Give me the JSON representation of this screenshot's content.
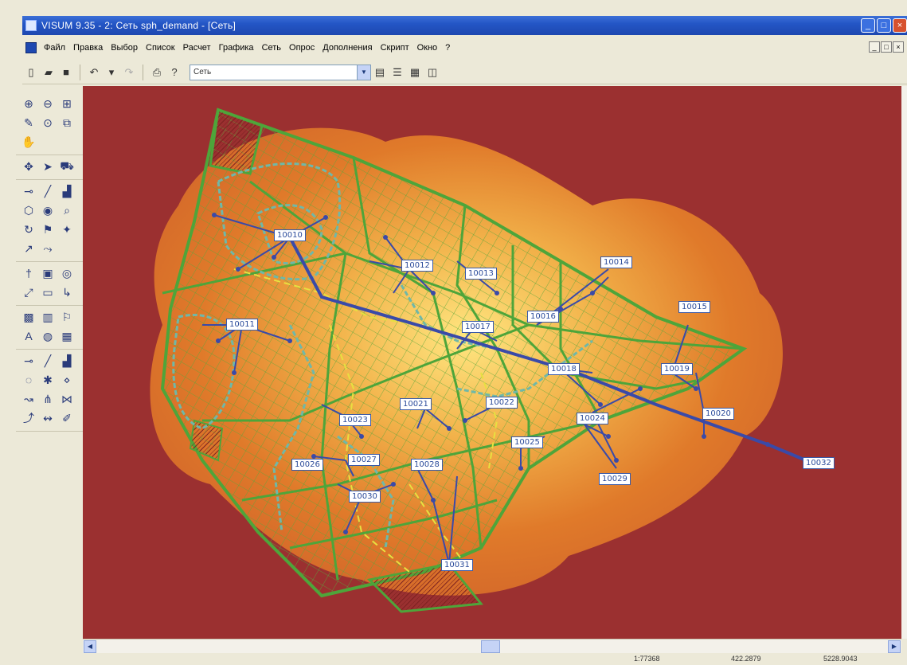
{
  "window": {
    "title": "VISUM 9.35 - 2: Сеть  sph_demand - [Сеть]",
    "buttons": [
      "_",
      "□",
      "×"
    ]
  },
  "menu": {
    "items": [
      "Файл",
      "Правка",
      "Выбор",
      "Список",
      "Расчет",
      "Графика",
      "Сеть",
      "Опрос",
      "Дополнения",
      "Скрипт",
      "Окно",
      "?"
    ],
    "mdi_buttons": [
      "_",
      "□",
      "×"
    ]
  },
  "toolbar": {
    "combo_value": "Сеть"
  },
  "map": {
    "colors": {
      "background": "#9b3030",
      "glow": "#e07a2a",
      "grid": "#5aa83a",
      "link": "#3a4aa8",
      "highlight": "#e8e040"
    },
    "node_labels": [
      "10010",
      "10011",
      "10012",
      "10013",
      "10014",
      "10015",
      "10016",
      "10017",
      "10018",
      "10019",
      "10020",
      "10021",
      "10022",
      "10023",
      "10024",
      "10025",
      "10026",
      "10027",
      "10028",
      "10029",
      "10030",
      "10031",
      "10032"
    ]
  },
  "status": {
    "scale": "1:77368",
    "x": "422.2879",
    "y": "5228.9043"
  }
}
